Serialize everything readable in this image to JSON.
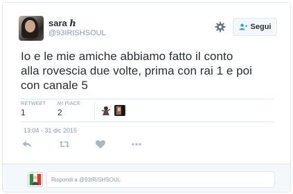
{
  "user": {
    "display_name": "sara",
    "name_symbol": "h",
    "handle": "@93IRISHSOUL"
  },
  "header": {
    "settings_icon": "gear-icon",
    "follow_label": "Segui",
    "follow_icon": "add-person-icon"
  },
  "tweet": {
    "text_line1": "Io e le mie amiche abbiamo fatto il conto",
    "text_line2": "alla rovescia due volte, prima con rai 1 e poi",
    "text_line3": "con canale 5"
  },
  "stats": {
    "retweet_label": "RETWEET",
    "retweet_count": "1",
    "likes_label": "MI PIACE",
    "likes_count": "2"
  },
  "timestamp": "13:04 - 31 dic 2015",
  "actions": [
    "reply-icon",
    "retweet-icon",
    "heart-icon",
    "more-icon"
  ],
  "reply": {
    "placeholder": "Rispondi a @93IRISHSOUL"
  },
  "colors": {
    "text": "#292f33",
    "muted": "#8899a6",
    "border": "#e1e8ed",
    "background_light": "#f5f8fa"
  }
}
